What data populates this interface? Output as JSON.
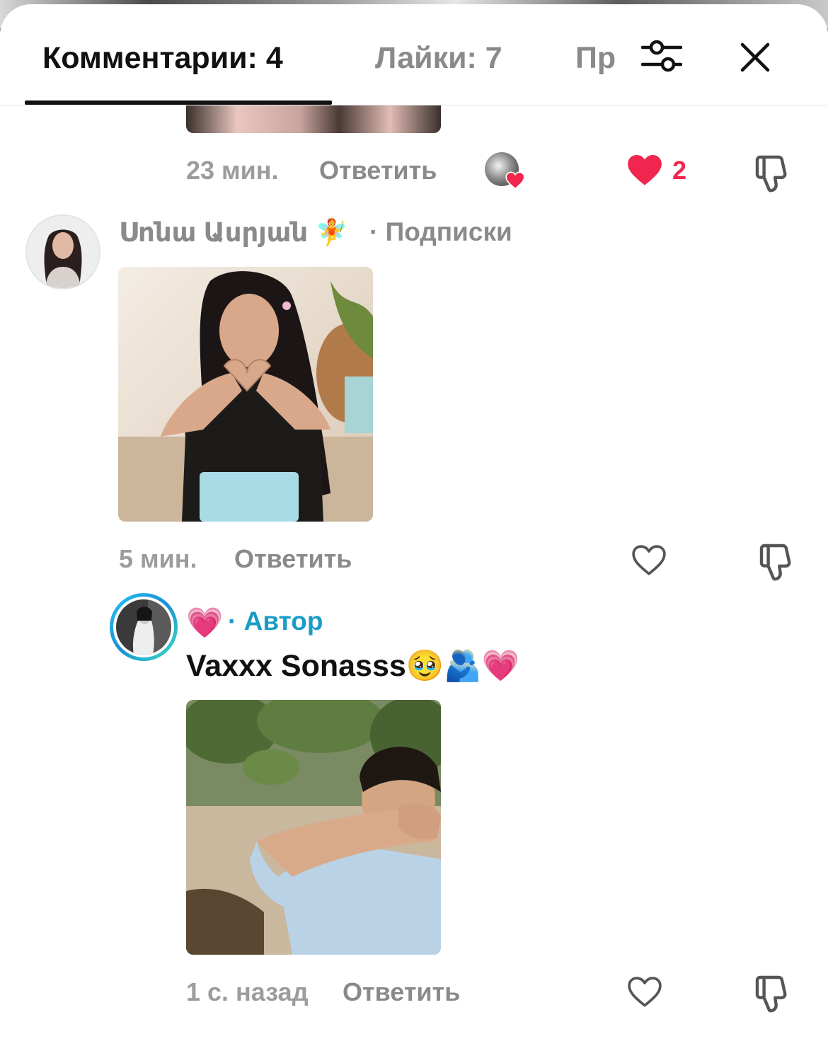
{
  "tabs": {
    "comments": "Комментарии: 4",
    "likes": "Лайки: 7",
    "more": "Пр"
  },
  "icons": {
    "filter": "sliders-icon",
    "close": "close-icon",
    "heart": "heart-icon",
    "dislike": "thumbs-down-icon"
  },
  "colors": {
    "like_active": "#f0264e",
    "author_badge": "#1a9cc7",
    "text_primary": "#111111",
    "text_secondary": "#8a8a8a"
  },
  "comment_prev": {
    "time": "23 мин.",
    "reply": "Ответить",
    "like_count": "2"
  },
  "comment_1": {
    "username": "Սոնա Ասրյան 🧚",
    "relation": "· Подписки",
    "time": "5 мин.",
    "reply": "Ответить"
  },
  "comment_2": {
    "username_emoji": "💗",
    "badge": "· Автор",
    "text": "Vaxxx Sonasss🥹🫂💗",
    "time": "1 с. назад",
    "reply": "Ответить"
  }
}
